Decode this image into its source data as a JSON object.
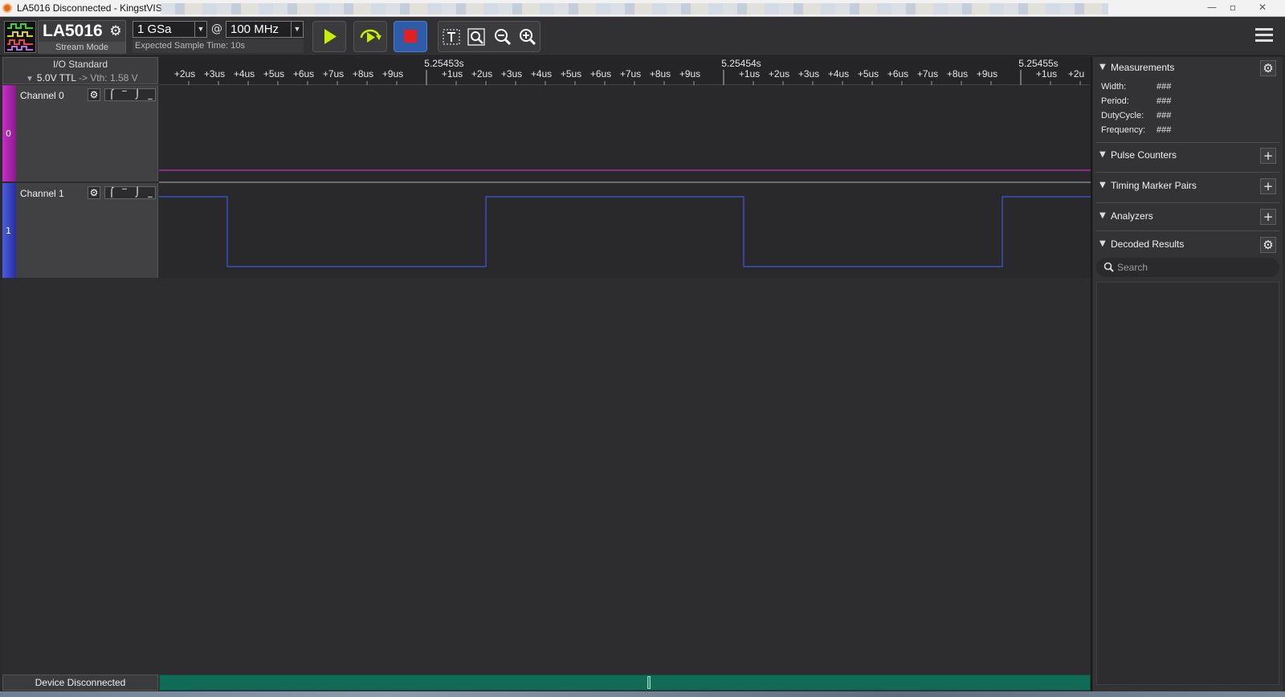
{
  "window": {
    "title": "LA5016 Disconnected - KingstVIS"
  },
  "device": {
    "name": "LA5016",
    "mode": "Stream Mode"
  },
  "sampling": {
    "depth": "1 GSa",
    "at": "@",
    "rate": "100 MHz",
    "expected": "Expected Sample Time: 10s"
  },
  "io": {
    "title": "I/O Standard",
    "standard": "5.0V TTL",
    "vth": "-> Vth: 1.58 V"
  },
  "channels": [
    {
      "name": "Channel 0",
      "index": "0",
      "color": "#c82fc8"
    },
    {
      "name": "Channel 1",
      "index": "1",
      "color": "#3f57e0"
    }
  ],
  "ruler": {
    "ticks": [
      "+2us",
      "+3us",
      "+4us",
      "+5us",
      "+6us",
      "+7us",
      "+8us",
      "+9us",
      "+1us",
      "+2us",
      "+3us",
      "+4us",
      "+5us",
      "+6us",
      "+7us",
      "+8us",
      "+9us",
      "+1us",
      "+2us",
      "+3us",
      "+4us",
      "+5us",
      "+6us",
      "+7us",
      "+8us",
      "+9us",
      "+1us",
      "+2u"
    ],
    "majors": [
      "5.25453s",
      "5.25454s",
      "5.25455s"
    ]
  },
  "measurements": {
    "title": "Measurements",
    "rows": [
      {
        "label": "Width:",
        "value": "###"
      },
      {
        "label": "Period:",
        "value": "###"
      },
      {
        "label": "DutyCycle:",
        "value": "###"
      },
      {
        "label": "Frequency:",
        "value": "###"
      }
    ]
  },
  "sections": {
    "pulse_counters": "Pulse Counters",
    "timing_markers": "Timing Marker Pairs",
    "analyzers": "Analyzers",
    "decoded": "Decoded Results"
  },
  "search": {
    "placeholder": "Search"
  },
  "status": {
    "text": "Device Disconnected"
  },
  "colors": {
    "accent": "#2f5ca8",
    "progress": "#0f6b55",
    "play": "#c8ef00"
  }
}
